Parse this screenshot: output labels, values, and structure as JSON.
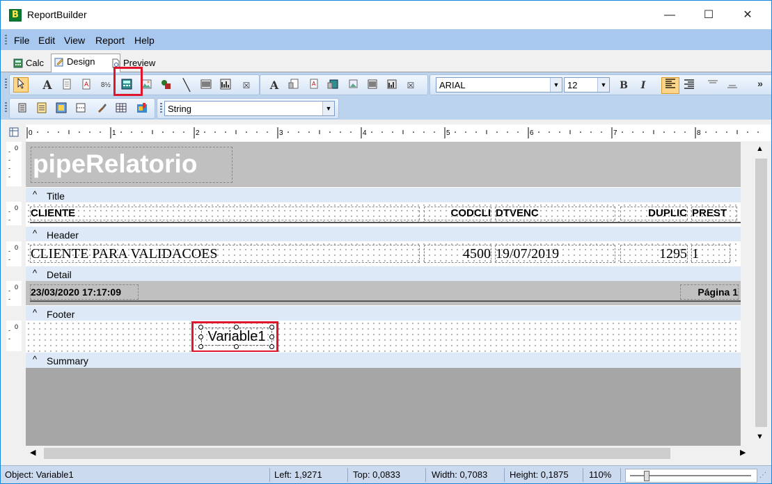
{
  "window": {
    "title": "ReportBuilder",
    "app_icon_letter": "B",
    "controls": {
      "minimize": "—",
      "maximize": "☐",
      "close": "✕"
    }
  },
  "menu": {
    "items": [
      "File",
      "Edit",
      "View",
      "Report",
      "Help"
    ]
  },
  "tabs": [
    {
      "label": "Calc"
    },
    {
      "label": "Design",
      "active": true
    },
    {
      "label": "Preview"
    }
  ],
  "toolbar": {
    "font_name": "ARIAL",
    "font_size": "12",
    "data_type": "String",
    "bold_label": "B",
    "italic_label": "I",
    "overflow": "»"
  },
  "ruler": {
    "marks": [
      "0",
      "1",
      "2",
      "3",
      "4",
      "5",
      "6",
      "7",
      "8"
    ]
  },
  "report": {
    "header_title": "pipeRelatorio",
    "bands": {
      "title": "Title",
      "header": "Header",
      "detail": "Detail",
      "footer": "Footer",
      "summary": "Summary"
    },
    "columns": {
      "cliente": "CLIENTE",
      "codcli": "CODCLI",
      "dtvenc": "DTVENC",
      "duplic": "DUPLIC",
      "prest": "PREST"
    },
    "detail_row": {
      "cliente": "CLIENTE PARA VALIDACOES",
      "codcli": "4500",
      "dtvenc": "19/07/2019",
      "duplic": "1295",
      "prest": "1"
    },
    "footer_row": {
      "datetime": "23/03/2020 17:17:09",
      "page": "Página 1"
    },
    "selected_component": "Variable1",
    "band_ruler_zero": "0"
  },
  "status": {
    "object": "Object: Variable1",
    "left": "Left: 1,9271",
    "top": "Top: 0,0833",
    "width": "Width: 0,7083",
    "height": "Height: 0,1875",
    "zoom": "110%"
  },
  "colors": {
    "accent_red": "#e0142b",
    "menubar": "#a8c8f0",
    "toolbar": "#bcd3ee",
    "band_gray": "#c0c0c0"
  }
}
